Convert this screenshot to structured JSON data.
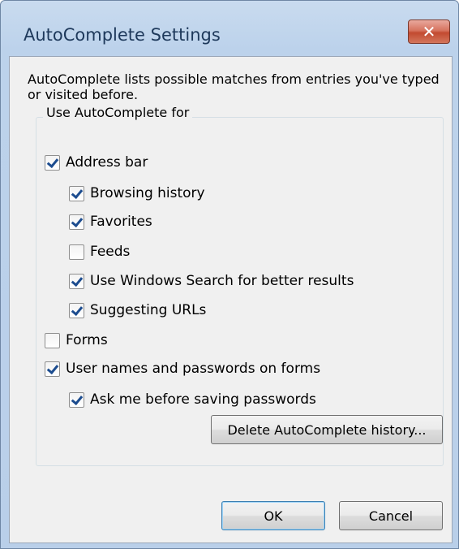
{
  "dialog": {
    "title": "AutoComplete Settings",
    "close_glyph": "✕",
    "description": "AutoComplete lists possible matches from entries you've typed or visited before.",
    "group_label": "Use AutoComplete for"
  },
  "options": [
    {
      "id": "address-bar",
      "label": "Address bar",
      "checked": true,
      "indent": 0
    },
    {
      "id": "browsing-history",
      "label": "Browsing history",
      "checked": true,
      "indent": 1
    },
    {
      "id": "favorites",
      "label": "Favorites",
      "checked": true,
      "indent": 1
    },
    {
      "id": "feeds",
      "label": "Feeds",
      "checked": false,
      "indent": 1
    },
    {
      "id": "windows-search",
      "label": "Use Windows Search for better results",
      "checked": true,
      "indent": 1
    },
    {
      "id": "suggesting-urls",
      "label": "Suggesting URLs",
      "checked": true,
      "indent": 1
    },
    {
      "id": "forms",
      "label": "Forms",
      "checked": false,
      "indent": 0
    },
    {
      "id": "user-names-passwords",
      "label": "User names and passwords on forms",
      "checked": true,
      "indent": 0
    },
    {
      "id": "ask-before-saving",
      "label": "Ask me before saving passwords",
      "checked": true,
      "indent": 1
    }
  ],
  "buttons": {
    "delete_history": "Delete AutoComplete history...",
    "ok": "OK",
    "cancel": "Cancel"
  },
  "colors": {
    "title_text": "#1e395b",
    "close_button": "#c24a30",
    "check_mark": "#1c4c8f"
  }
}
